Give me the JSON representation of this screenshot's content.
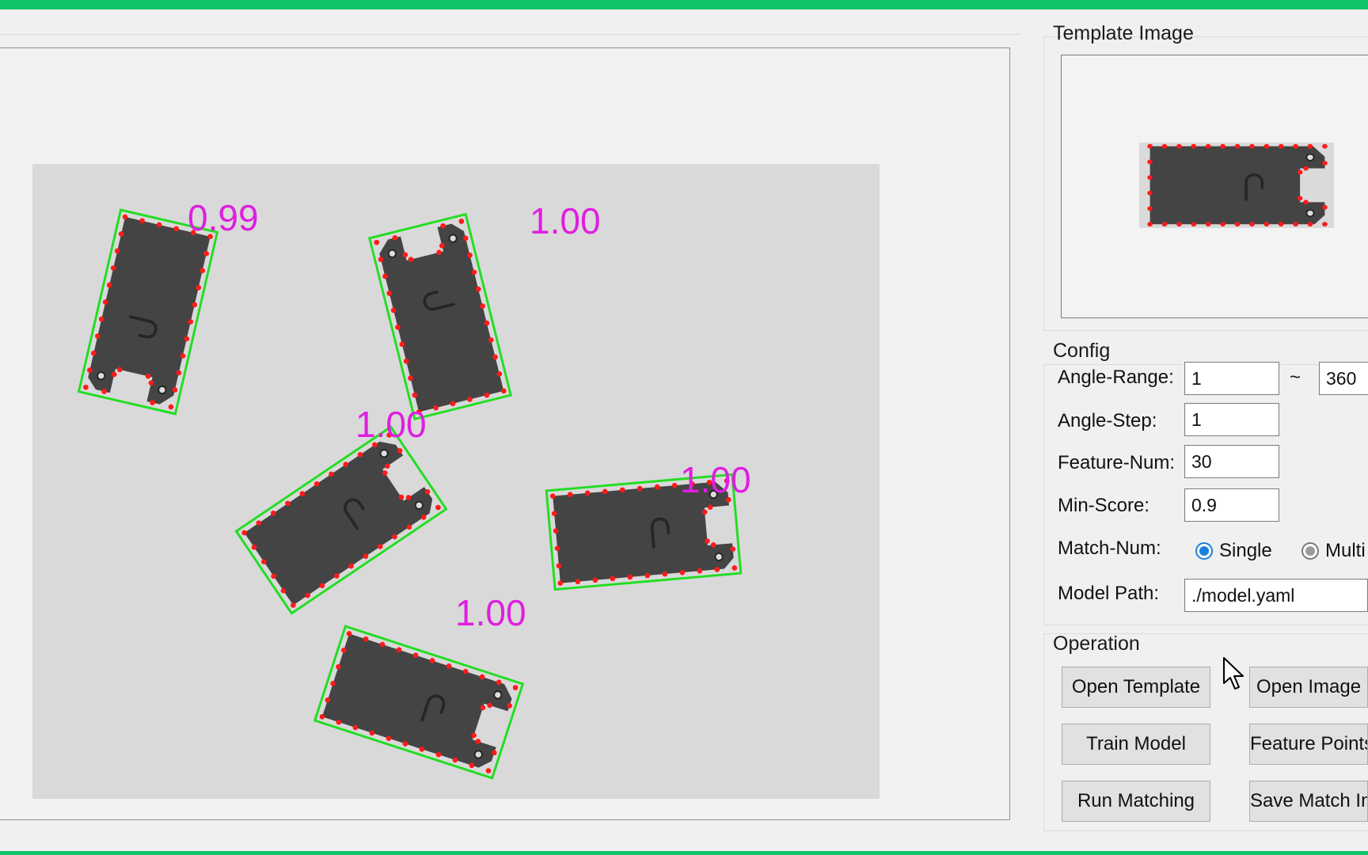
{
  "template_panel": {
    "title": "Template Image"
  },
  "config": {
    "title": "Config",
    "angle_range": {
      "label": "Angle-Range:",
      "min": "1",
      "separator": "~",
      "max": "360"
    },
    "angle_step": {
      "label": "Angle-Step:",
      "value": "1"
    },
    "feature_num": {
      "label": "Feature-Num:",
      "value": "30"
    },
    "min_score": {
      "label": "Min-Score:",
      "value": "0.9"
    },
    "match_num": {
      "label": "Match-Num:",
      "options": [
        "Single",
        "Multi"
      ],
      "selected": "Single"
    },
    "model_path": {
      "label": "Model Path:",
      "value": "./model.yaml"
    }
  },
  "operation": {
    "title": "Operation",
    "buttons": {
      "open_template": "Open Template",
      "open_image": "Open Image",
      "train_model": "Train Model",
      "feature_points": "Feature Points",
      "run_matching": "Run Matching",
      "save_match": "Save Match Image"
    }
  },
  "matches": [
    {
      "score": "0.99"
    },
    {
      "score": "1.00"
    },
    {
      "score": "1.00"
    },
    {
      "score": "1.00"
    },
    {
      "score": "1.00"
    }
  ],
  "colors": {
    "accent": "#0fc46a",
    "match_box": "#22dd22",
    "score_text": "#e01ee0",
    "feature_point": "#ff1a1a",
    "part_fill": "#444444",
    "radio_selected": "#1a7fdc"
  }
}
